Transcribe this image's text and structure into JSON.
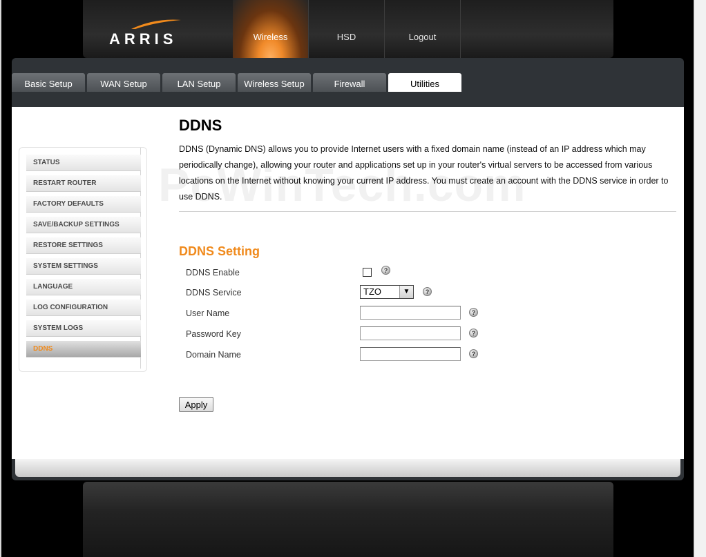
{
  "brand": {
    "logo_text": "ARRIS"
  },
  "top_nav": [
    {
      "label": "Wireless",
      "active": true
    },
    {
      "label": "HSD",
      "active": false
    },
    {
      "label": "Logout",
      "active": false
    }
  ],
  "tabs": [
    {
      "label": "Basic Setup"
    },
    {
      "label": "WAN Setup"
    },
    {
      "label": "LAN Setup"
    },
    {
      "label": "Wireless Setup"
    },
    {
      "label": "Firewall"
    },
    {
      "label": "Utilities",
      "active": true
    }
  ],
  "sidebar": {
    "items": [
      {
        "label": "STATUS"
      },
      {
        "label": "RESTART ROUTER"
      },
      {
        "label": "FACTORY DEFAULTS"
      },
      {
        "label": "SAVE/BACKUP SETTINGS"
      },
      {
        "label": "RESTORE SETTINGS"
      },
      {
        "label": "SYSTEM SETTINGS"
      },
      {
        "label": "LANGUAGE"
      },
      {
        "label": "LOG CONFIGURATION"
      },
      {
        "label": "SYSTEM LOGS"
      },
      {
        "label": "DDNS",
        "active": true
      }
    ]
  },
  "page": {
    "title": "DDNS",
    "description": "DDNS (Dynamic DNS) allows you to provide Internet users with a fixed domain name (instead of an IP address which may periodically change), allowing your router and applications set up in your router's virtual servers to be accessed from various locations on the Internet without knowing your current IP address. You must create an account with the DDNS service in order to use DDNS.",
    "watermark": "PcWinTech.com"
  },
  "form": {
    "section_title": "DDNS Setting",
    "ddns_enable": {
      "label": "DDNS Enable",
      "checked": false
    },
    "ddns_service": {
      "label": "DDNS Service",
      "value": "TZO"
    },
    "user_name": {
      "label": "User Name",
      "value": ""
    },
    "password_key": {
      "label": "Password Key",
      "value": ""
    },
    "domain_name": {
      "label": "Domain Name",
      "value": ""
    },
    "help_glyph": "?",
    "apply_label": "Apply"
  },
  "colors": {
    "accent": "#f08a1c",
    "chrome": "#2f3337",
    "background": "#000000"
  }
}
